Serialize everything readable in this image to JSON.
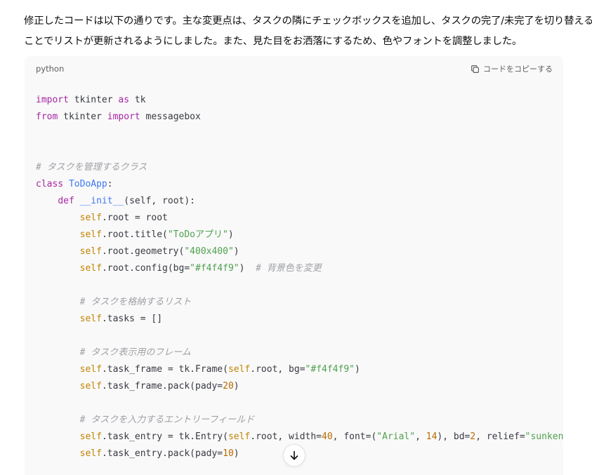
{
  "message": {
    "line1": "修正したコードは以下の通りです。主な変更点は、タスクの隣にチェックボックスを追加し、タスクの完了/未完了を切り替える",
    "line2": "ことでリストが更新されるようにしました。また、見た目をお洒落にするため、色やフォントを調整しました。"
  },
  "code_block": {
    "language": "python",
    "copy_label": "コードをコピーする",
    "copy_icon": "copy-icon",
    "lines": [
      [
        [
          "kw",
          "import"
        ],
        [
          "p",
          " tkinter "
        ],
        [
          "kw",
          "as"
        ],
        [
          "p",
          " tk"
        ]
      ],
      [
        [
          "kw",
          "from"
        ],
        [
          "p",
          " tkinter "
        ],
        [
          "kw",
          "import"
        ],
        [
          "p",
          " messagebox"
        ]
      ],
      [],
      [],
      [
        [
          "cm",
          "# タスクを管理するクラス"
        ]
      ],
      [
        [
          "kw",
          "class"
        ],
        [
          "p",
          " "
        ],
        [
          "cls",
          "ToDoApp"
        ],
        [
          "p",
          ":"
        ]
      ],
      [
        [
          "p",
          "    "
        ],
        [
          "kw",
          "def"
        ],
        [
          "p",
          " "
        ],
        [
          "fn",
          "__init__"
        ],
        [
          "p",
          "(self, root):"
        ]
      ],
      [
        [
          "p",
          "        "
        ],
        [
          "self",
          "self"
        ],
        [
          "p",
          ".root = root"
        ]
      ],
      [
        [
          "p",
          "        "
        ],
        [
          "self",
          "self"
        ],
        [
          "p",
          ".root.title("
        ],
        [
          "str",
          "\"ToDoアプリ\""
        ],
        [
          "p",
          ")"
        ]
      ],
      [
        [
          "p",
          "        "
        ],
        [
          "self",
          "self"
        ],
        [
          "p",
          ".root.geometry("
        ],
        [
          "str",
          "\"400x400\""
        ],
        [
          "p",
          ")"
        ]
      ],
      [
        [
          "p",
          "        "
        ],
        [
          "self",
          "self"
        ],
        [
          "p",
          ".root.config(bg="
        ],
        [
          "str",
          "\"#f4f4f9\""
        ],
        [
          "p",
          ")  "
        ],
        [
          "cm",
          "# 背景色を変更"
        ]
      ],
      [],
      [
        [
          "p",
          "        "
        ],
        [
          "cm",
          "# タスクを格納するリスト"
        ]
      ],
      [
        [
          "p",
          "        "
        ],
        [
          "self",
          "self"
        ],
        [
          "p",
          ".tasks = []"
        ]
      ],
      [],
      [
        [
          "p",
          "        "
        ],
        [
          "cm",
          "# タスク表示用のフレーム"
        ]
      ],
      [
        [
          "p",
          "        "
        ],
        [
          "self",
          "self"
        ],
        [
          "p",
          ".task_frame = tk.Frame("
        ],
        [
          "self",
          "self"
        ],
        [
          "p",
          ".root, bg="
        ],
        [
          "str",
          "\"#f4f4f9\""
        ],
        [
          "p",
          ")"
        ]
      ],
      [
        [
          "p",
          "        "
        ],
        [
          "self",
          "self"
        ],
        [
          "p",
          ".task_frame.pack(pady="
        ],
        [
          "num",
          "20"
        ],
        [
          "p",
          ")"
        ]
      ],
      [],
      [
        [
          "p",
          "        "
        ],
        [
          "cm",
          "# タスクを入力するエントリーフィールド"
        ]
      ],
      [
        [
          "p",
          "        "
        ],
        [
          "self",
          "self"
        ],
        [
          "p",
          ".task_entry = tk.Entry("
        ],
        [
          "self",
          "self"
        ],
        [
          "p",
          ".root, width="
        ],
        [
          "num",
          "40"
        ],
        [
          "p",
          ", font=("
        ],
        [
          "str",
          "\"Arial\""
        ],
        [
          "p",
          ", "
        ],
        [
          "num",
          "14"
        ],
        [
          "p",
          "), bd="
        ],
        [
          "num",
          "2"
        ],
        [
          "p",
          ", relief="
        ],
        [
          "str",
          "\"sunken\""
        ],
        [
          "p",
          ")"
        ]
      ],
      [
        [
          "p",
          "        "
        ],
        [
          "self",
          "self"
        ],
        [
          "p",
          ".task_entry.pack(pady="
        ],
        [
          "num",
          "10"
        ],
        [
          "p",
          ")"
        ]
      ]
    ]
  },
  "scroll_button": {
    "icon": "arrow-down-icon"
  }
}
